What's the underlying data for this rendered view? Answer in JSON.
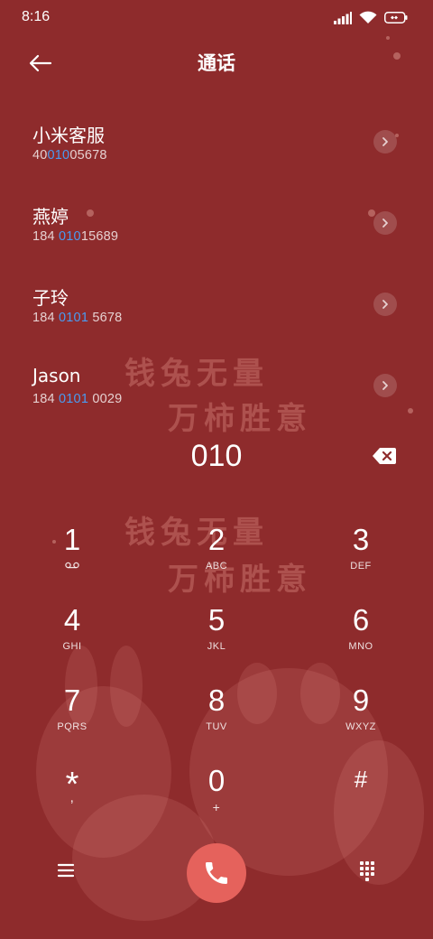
{
  "status_bar": {
    "time": "8:16",
    "icons": [
      "signal-icon",
      "wifi-icon",
      "battery-icon"
    ]
  },
  "header": {
    "title": "通话",
    "back_icon": "arrow-left-icon"
  },
  "contacts": [
    {
      "name": "小米客服",
      "number_pre": "40",
      "number_match": "010",
      "number_post": "05678"
    },
    {
      "name": "燕婷",
      "number_pre": "184 ",
      "number_match": "010",
      "number_post": "15689"
    },
    {
      "name": "子玲",
      "number_pre": "184 ",
      "number_match": "0101",
      "number_post": " 5678"
    },
    {
      "name": "Jason",
      "number_pre": "184 ",
      "number_match": "0101",
      "number_post": " 0029"
    }
  ],
  "dialed_number": "010",
  "wallpaper_text": {
    "line1": "钱兔无量",
    "line2": "万柿胜意"
  },
  "keypad": [
    {
      "digit": "1",
      "letters": ""
    },
    {
      "digit": "2",
      "letters": "ABC"
    },
    {
      "digit": "3",
      "letters": "DEF"
    },
    {
      "digit": "4",
      "letters": "GHI"
    },
    {
      "digit": "5",
      "letters": "JKL"
    },
    {
      "digit": "6",
      "letters": "MNO"
    },
    {
      "digit": "7",
      "letters": "PQRS"
    },
    {
      "digit": "8",
      "letters": "TUV"
    },
    {
      "digit": "9",
      "letters": "WXYZ"
    },
    {
      "digit": "*",
      "letters": ","
    },
    {
      "digit": "0",
      "letters": "+"
    },
    {
      "digit": "#",
      "letters": ""
    }
  ],
  "colors": {
    "background": "#8e2b2c",
    "match_highlight": "#4a9bf0",
    "call_button": "#e5625c"
  }
}
